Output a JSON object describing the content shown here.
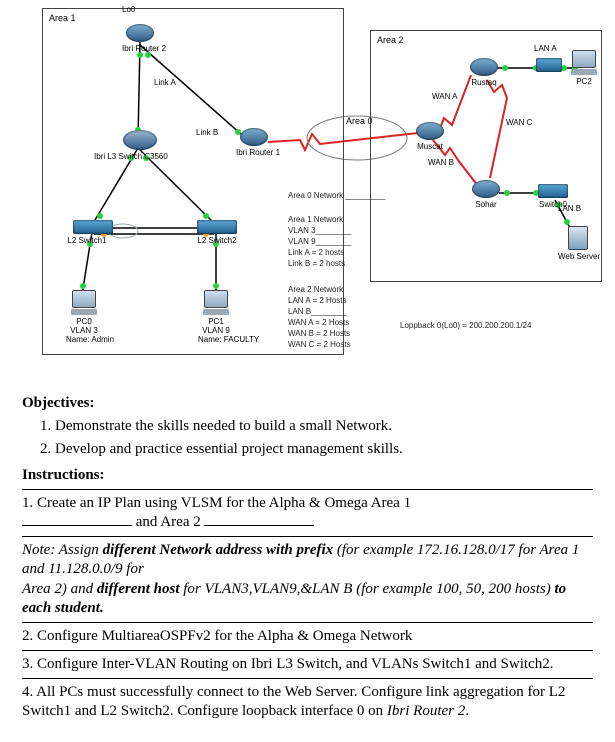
{
  "diagram": {
    "area1": {
      "title": "Area 1"
    },
    "area2": {
      "title": "Area 2"
    },
    "area0_label": "Area 0",
    "devices": {
      "ibri_router2": {
        "name": "Ibri Router 2",
        "lo": "Lo0"
      },
      "ibri_router1": {
        "name": "Ibri Router 1"
      },
      "ibri_l3_switch": {
        "name": "Ibri L3 Switch C3560"
      },
      "l2_switch1": {
        "name": "L2 Switch1"
      },
      "l2_switch2": {
        "name": "L2 Switch2"
      },
      "pc0": {
        "name": "PC0",
        "vlan": "VLAN 3",
        "user": "Name: Admin"
      },
      "pc1": {
        "name": "PC1",
        "vlan": "VLAN 9",
        "user": "Name: FACULTY"
      },
      "muscat": {
        "name": "Muscat"
      },
      "rustaq": {
        "name": "Rustaq"
      },
      "sohar": {
        "name": "Sohar"
      },
      "switch0": {
        "name": "Switch0"
      },
      "pc2": {
        "name": "PC2"
      },
      "web_server": {
        "name": "Web Server"
      }
    },
    "links": {
      "linkA": "Link A",
      "linkB": "Link B",
      "wanA": "WAN A",
      "wanB": "WAN B",
      "wanC": "WAN C",
      "lanA": "LAN A",
      "lanB": "LAN B"
    },
    "notes": {
      "area0": {
        "line1": "Area 0 Network _________"
      },
      "area1": {
        "line1": "Area 1 Network",
        "line2": "VLAN 3________",
        "line3": "VLAN 9________",
        "line4": "Link A = 2 hosts",
        "line5": "Link B = 2 hosts"
      },
      "area2": {
        "line1": "Area 2 Network",
        "line2": "LAN A = 2 Hosts",
        "line3": "LAN B________",
        "line4": "WAN A = 2 Hosts",
        "line5": "WAN B = 2 Hosts",
        "line6": "WAN C = 2 Hosts"
      },
      "loopback": "Loppback 0(Lo0) = 200.200.200.1/24"
    }
  },
  "text": {
    "objectives_h": "Objectives:",
    "obj1": "1. Demonstrate the skills needed to build a small Network.",
    "obj2": "2. Develop and practice essential project management skills.",
    "instructions_h": "Instructions:",
    "ins1a": "1. Create an IP Plan using VLSM for the Alpha & Omega Area 1",
    "ins1b_and": " and Area 2 ",
    "note_prefix": "Note: Assign ",
    "note_bold1": "different",
    "note_mid": " Network address with prefix",
    "note_paren1": " (for example 172.16.128.0/17 for Area 1 and 11.128.0.0/9 for",
    "note_line3a": "Area 2) and ",
    "note_bold2": "different host",
    "note_line3b": " for VLAN3,VLAN9,&LAN B (for example 100, 50, 200 hosts) ",
    "note_bold3": "to each student.",
    "ins2": "2. Configure MultiareaOSPFv2 for the Alpha & Omega Network",
    "ins3": "3. Configure Inter-VLAN Routing on Ibri L3 Switch, and VLANs Switch1 and Switch2.",
    "ins4a": "4. All PCs must successfully connect to the Web Server. Configure link aggregation for L2 Switch1 and L2 Switch2. Configure loopback interface 0 on ",
    "ins4b": "Ibri Router 2",
    "ins4c": "."
  }
}
